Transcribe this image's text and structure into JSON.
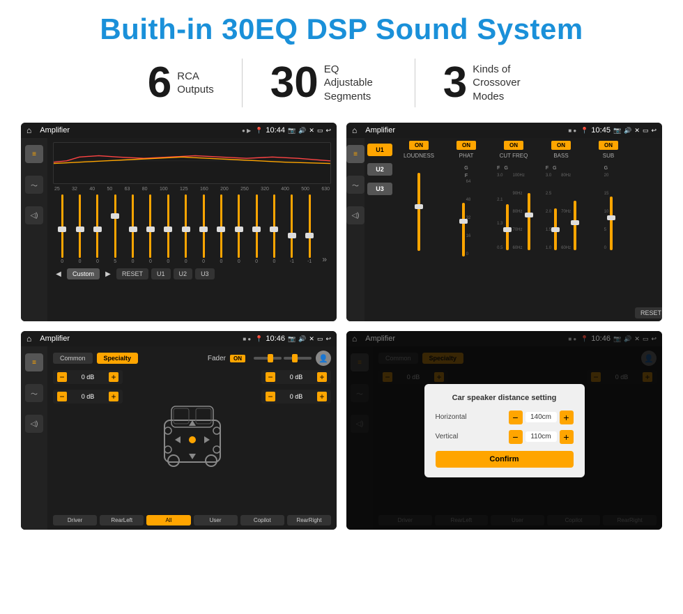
{
  "header": {
    "title": "Buith-in 30EQ DSP Sound System"
  },
  "stats": [
    {
      "number": "6",
      "label": "RCA\nOutputs"
    },
    {
      "number": "30",
      "label": "EQ Adjustable\nSegments"
    },
    {
      "number": "3",
      "label": "Kinds of\nCrossover Modes"
    }
  ],
  "screens": {
    "eq": {
      "title": "Amplifier",
      "time": "10:44",
      "freq_labels": [
        "25",
        "32",
        "40",
        "50",
        "63",
        "80",
        "100",
        "125",
        "160",
        "200",
        "250",
        "320",
        "400",
        "500",
        "630"
      ],
      "values": [
        "0",
        "0",
        "0",
        "5",
        "0",
        "0",
        "0",
        "0",
        "0",
        "0",
        "0",
        "0",
        "0",
        "-1",
        "0",
        "-1"
      ],
      "preset": "Custom",
      "buttons": [
        "RESET",
        "U1",
        "U2",
        "U3"
      ]
    },
    "crossover": {
      "title": "Amplifier",
      "time": "10:45",
      "channels": [
        "LOUDNESS",
        "PHAT",
        "CUT FREQ",
        "BASS",
        "SUB"
      ],
      "u_labels": [
        "U1",
        "U2",
        "U3"
      ],
      "reset": "RESET"
    },
    "fader": {
      "title": "Amplifier",
      "time": "10:46",
      "tabs": [
        "Common",
        "Specialty"
      ],
      "fader_label": "Fader",
      "db_values": [
        "0 dB",
        "0 dB",
        "0 dB",
        "0 dB"
      ],
      "bottom_buttons": [
        "Driver",
        "RearLeft",
        "All",
        "User",
        "Copilot",
        "RearRight"
      ]
    },
    "dialog": {
      "title": "Amplifier",
      "time": "10:46",
      "tabs": [
        "Common",
        "Specialty"
      ],
      "dialog_title": "Car speaker distance setting",
      "horizontal_label": "Horizontal",
      "horizontal_value": "140cm",
      "vertical_label": "Vertical",
      "vertical_value": "110cm",
      "confirm_label": "Confirm",
      "db_values": [
        "0 dB",
        "0 dB"
      ]
    }
  }
}
